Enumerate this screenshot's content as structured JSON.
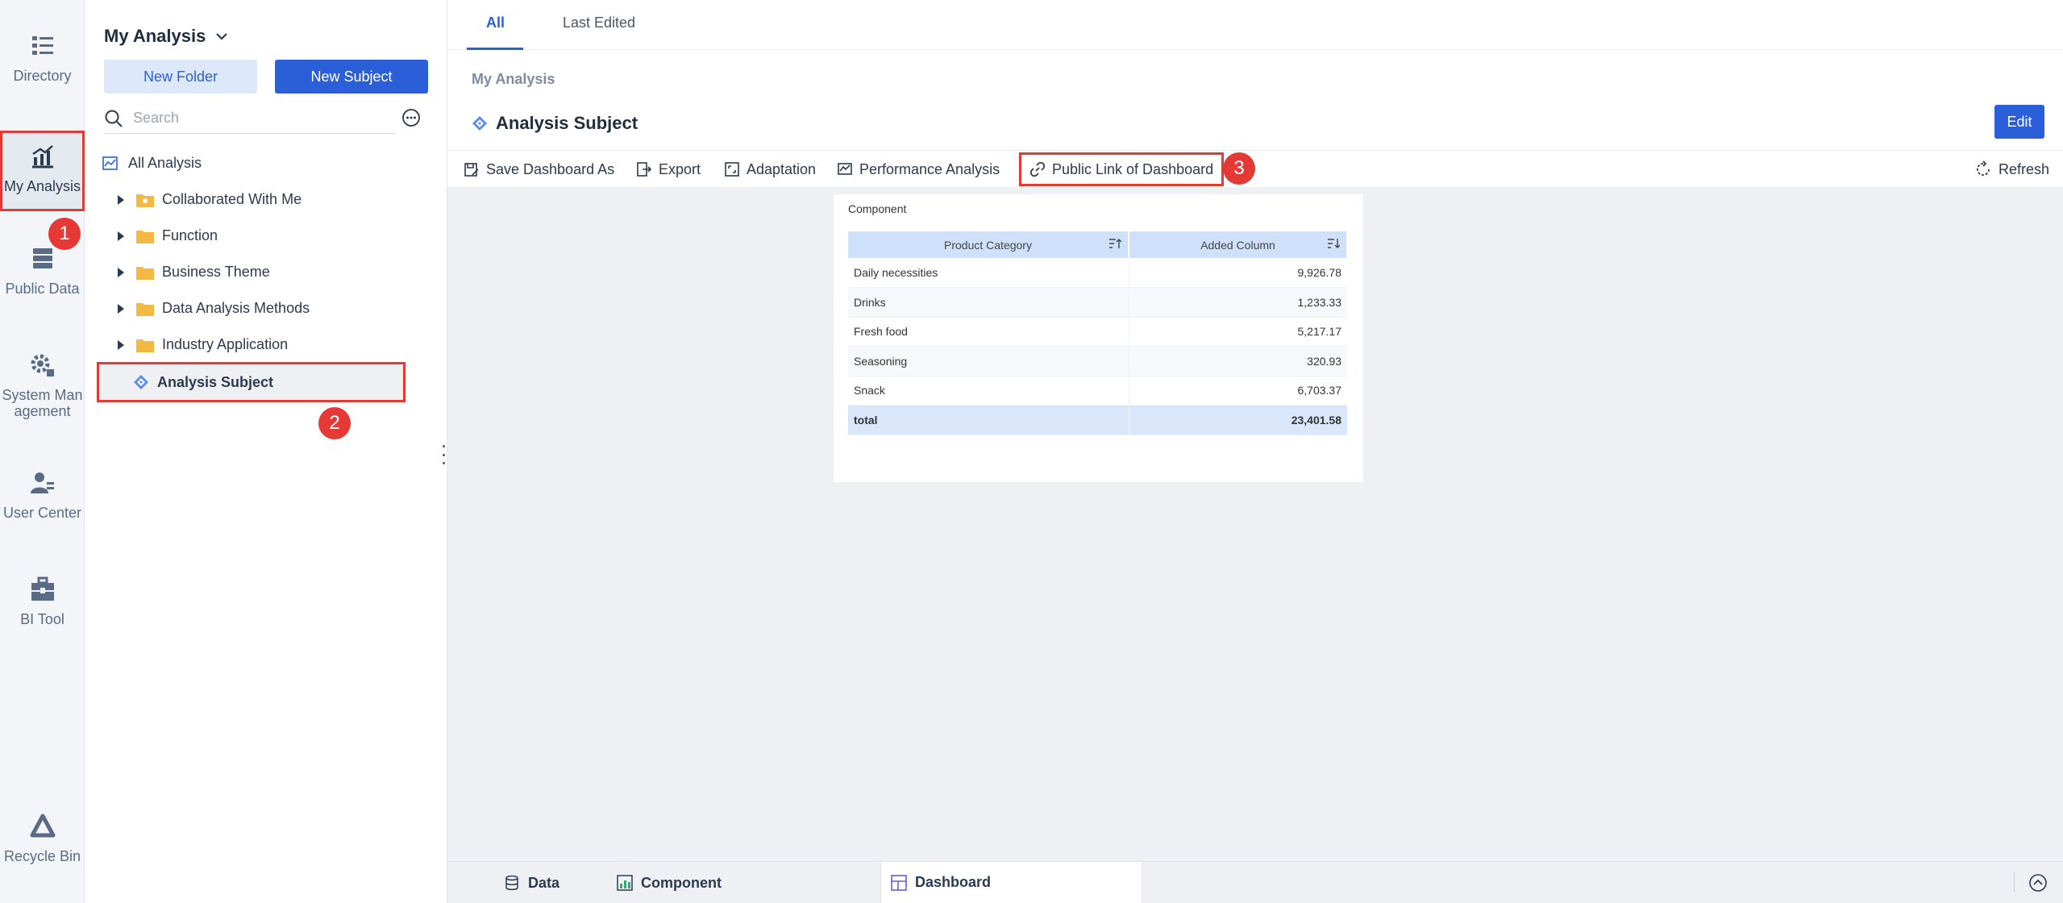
{
  "sidebar": {
    "items": [
      {
        "label": "Directory",
        "icon": "directory-icon"
      },
      {
        "label": "My Analysis",
        "icon": "analysis-chart-icon"
      },
      {
        "label": "Public Data",
        "icon": "database-icon"
      },
      {
        "label": "System Man agement",
        "icon": "gear-icon"
      },
      {
        "label": "User Center",
        "icon": "user-icon"
      },
      {
        "label": "BI Tool",
        "icon": "toolbox-icon"
      },
      {
        "label": "Recycle Bin",
        "icon": "recycle-icon"
      }
    ]
  },
  "tree": {
    "title": "My Analysis",
    "new_folder": "New Folder",
    "new_subject": "New Subject",
    "search_placeholder": "Search",
    "all_analysis": "All Analysis",
    "folders": [
      "Collaborated With Me",
      "Function",
      "Business Theme",
      "Data Analysis Methods",
      "Industry Application"
    ],
    "subject": "Analysis Subject"
  },
  "badges": {
    "one": "1",
    "two": "2",
    "three": "3"
  },
  "main": {
    "tabs": [
      "All",
      "Last Edited"
    ],
    "breadcrumb": "My Analysis",
    "title": "Analysis Subject",
    "edit": "Edit",
    "toolbar": {
      "save": "Save Dashboard As",
      "export": "Export",
      "adaptation": "Adaptation",
      "performance": "Performance Analysis",
      "public_link": "Public Link of Dashboard",
      "refresh": "Refresh"
    }
  },
  "component": {
    "title": "Component",
    "headers": [
      "Product Category",
      "Added Column"
    ],
    "rows": [
      [
        "Daily necessities",
        "9,926.78"
      ],
      [
        "Drinks",
        "1,233.33"
      ],
      [
        "Fresh food",
        "5,217.17"
      ],
      [
        "Seasoning",
        "320.93"
      ],
      [
        "Snack",
        "6,703.37"
      ]
    ],
    "total": [
      "total",
      "23,401.58"
    ]
  },
  "bottom": {
    "data": "Data",
    "component": "Component",
    "dashboard": "Dashboard"
  },
  "colors": {
    "accent": "#2b5fd9",
    "highlight": "#e53935"
  }
}
